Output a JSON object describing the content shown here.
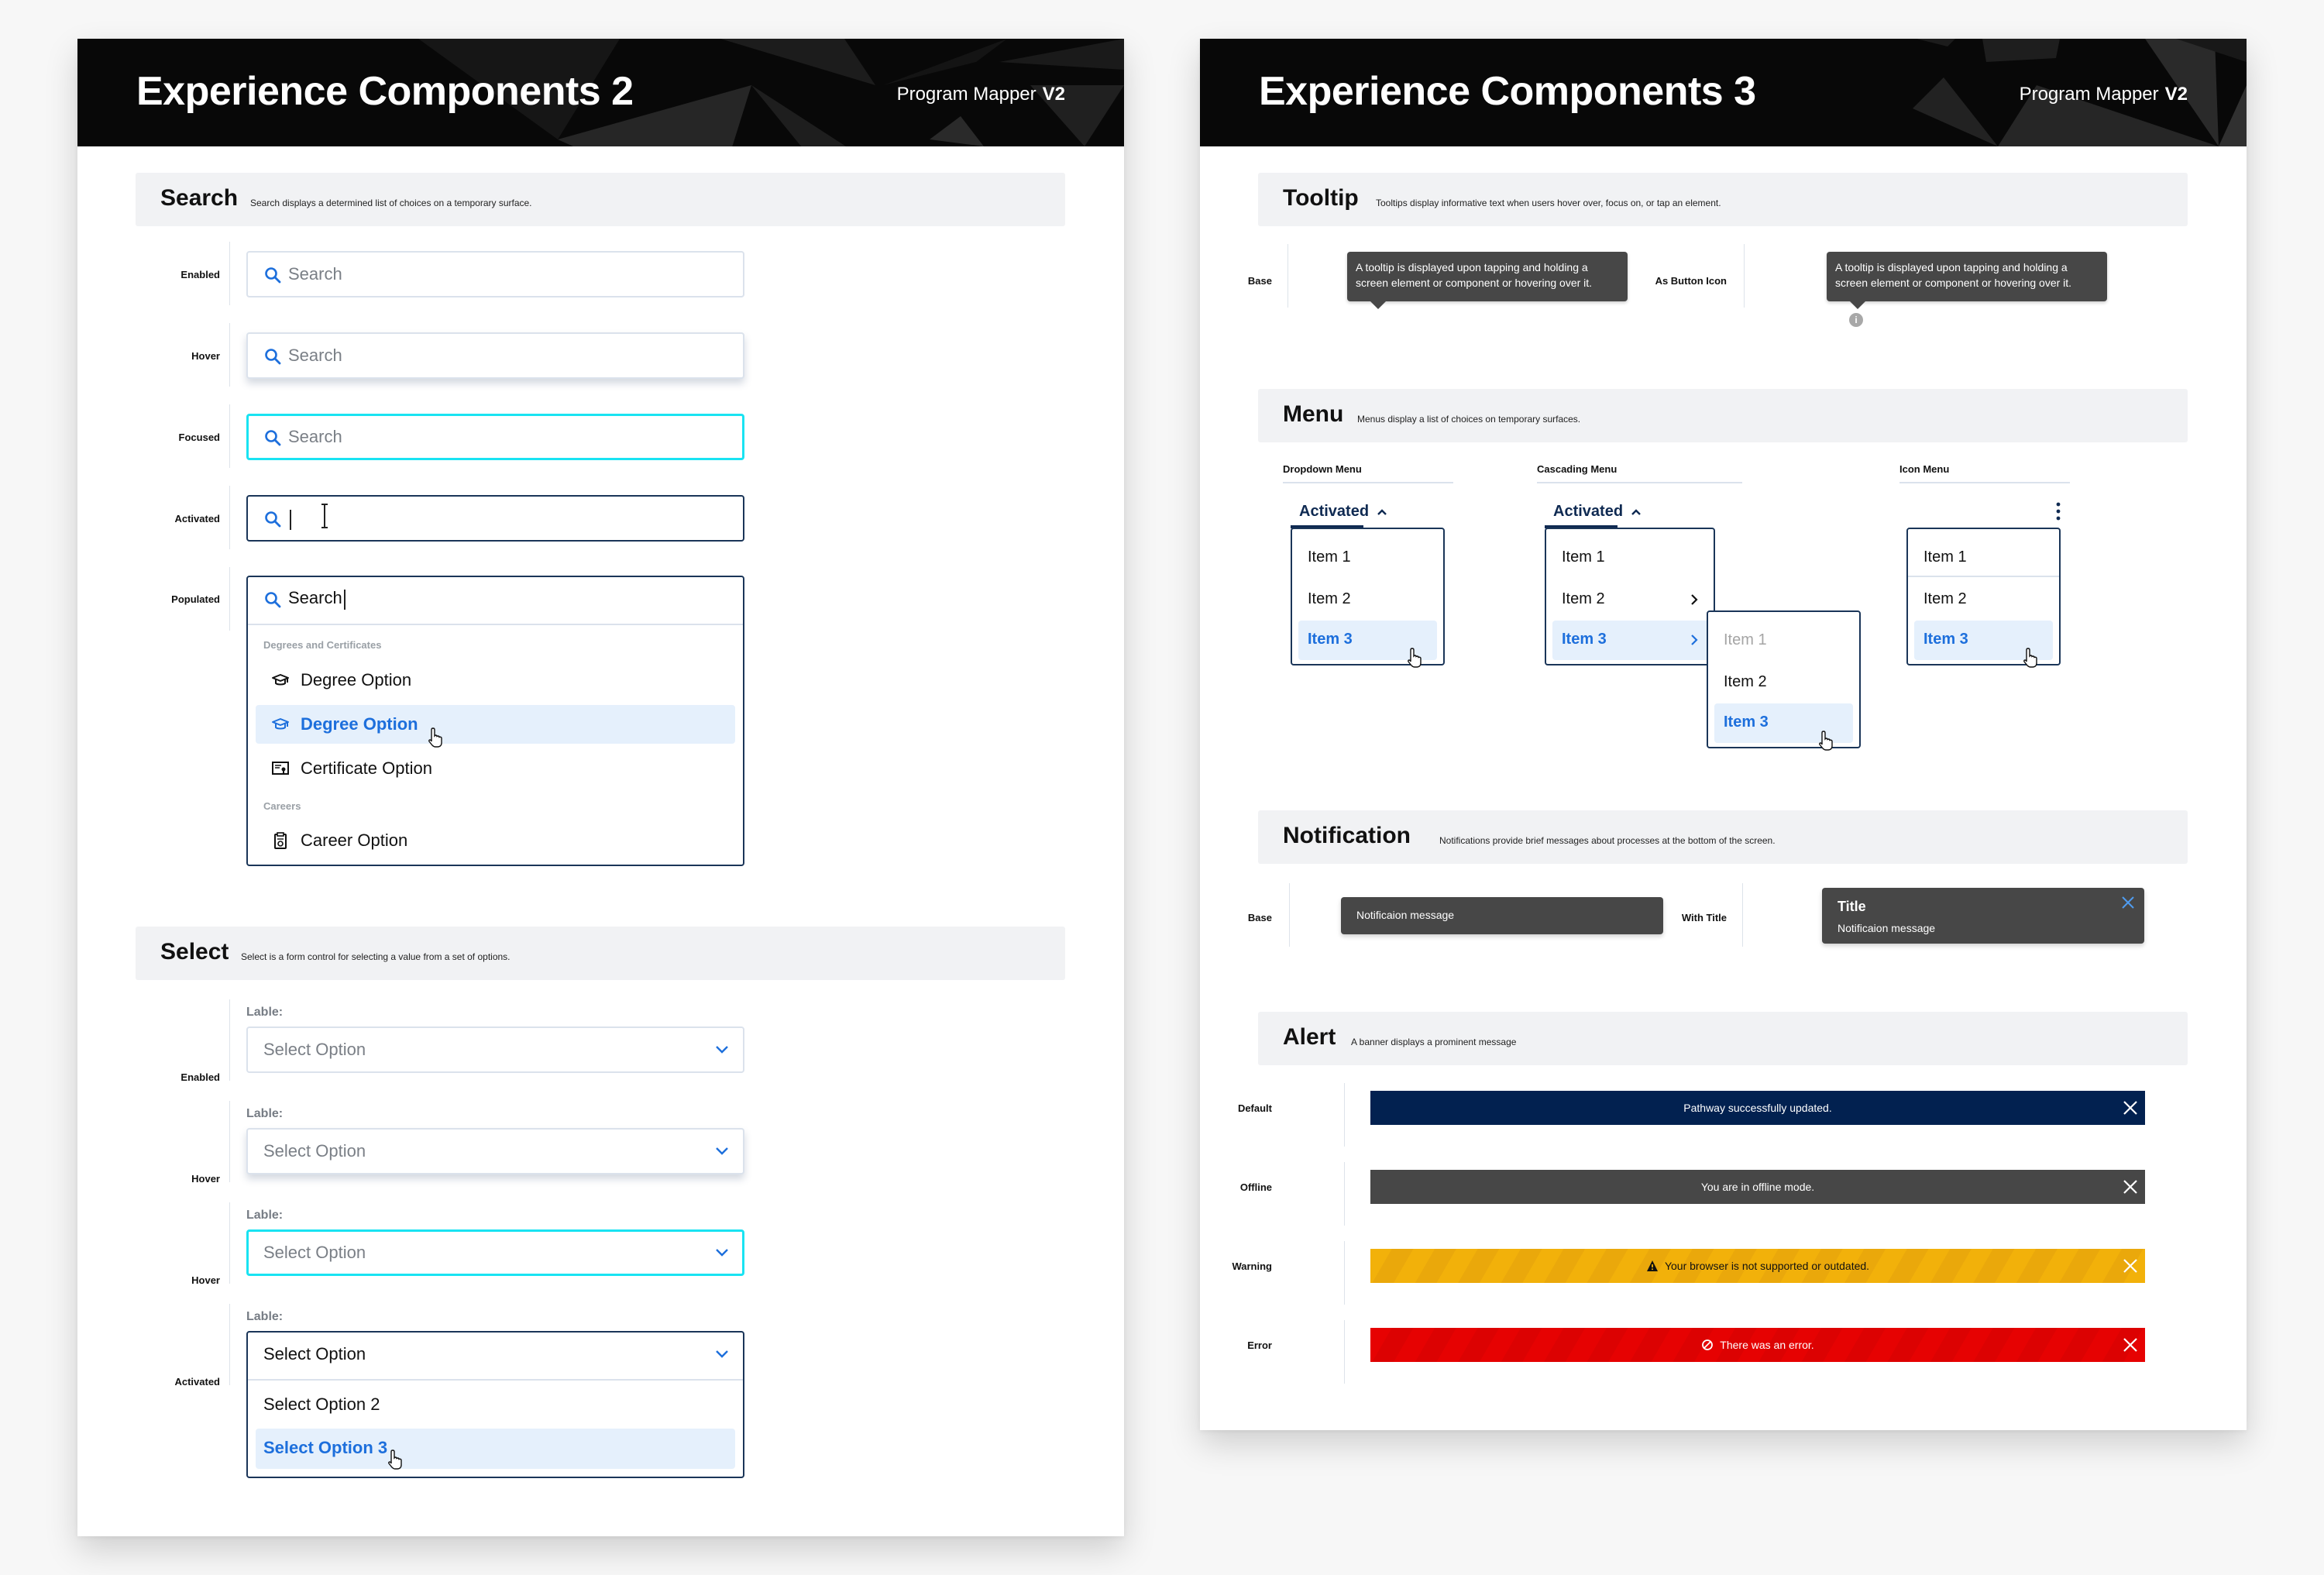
{
  "left_page": {
    "title": "Experience Components 2",
    "brand": "Program Mapper",
    "version": "V2",
    "search": {
      "title": "Search",
      "description": "Search displays a determined list of choices on a temporary surface.",
      "states": [
        {
          "label": "Enabled",
          "placeholder": "Search"
        },
        {
          "label": "Hover",
          "placeholder": "Search"
        },
        {
          "label": "Focused",
          "placeholder": "Search"
        },
        {
          "label": "Activated",
          "value": ""
        },
        {
          "label": "Populated",
          "value": "Search"
        }
      ],
      "results": {
        "groups": [
          {
            "label": "Degrees and Certificates",
            "options": [
              {
                "label": "Degree Option",
                "icon": "graduation-cap-icon",
                "highlighted": false
              },
              {
                "label": "Degree Option",
                "icon": "graduation-cap-icon",
                "highlighted": true
              },
              {
                "label": "Certificate Option",
                "icon": "certificate-icon",
                "highlighted": false
              }
            ]
          },
          {
            "label": "Careers",
            "options": [
              {
                "label": "Career Option",
                "icon": "clipboard-icon",
                "highlighted": false
              }
            ]
          }
        ]
      }
    },
    "select": {
      "title": "Select",
      "description": "Select is a form control for selecting a value from a set of options.",
      "field_label": "Lable:",
      "states": [
        {
          "label": "Enabled",
          "value": "Select Option"
        },
        {
          "label": "Hover",
          "value": "Select Option"
        },
        {
          "label": "Hover",
          "value": "Select Option"
        },
        {
          "label": "Activated",
          "value": "Select Option"
        }
      ],
      "options": [
        {
          "label": "Select Option 2",
          "highlighted": false
        },
        {
          "label": "Select Option 3",
          "highlighted": true
        }
      ]
    }
  },
  "right_page": {
    "title": "Experience Components 3",
    "brand": "Program Mapper",
    "version": "V2",
    "tooltip": {
      "title": "Tooltip",
      "description": "Tooltips display informative text when users hover over, focus on, or tap an element.",
      "variants": [
        {
          "label": "Base",
          "text": "A tooltip is displayed upon tapping and holding a screen element or component or hovering over it."
        },
        {
          "label": "As  Button Icon",
          "text": "A tooltip is displayed upon tapping and holding a screen element or component or hovering over it.",
          "icon": "info-icon",
          "icon_glyph": "i"
        }
      ]
    },
    "menu": {
      "title": "Menu",
      "description": "Menus display a list of choices on temporary surfaces.",
      "dropdown": {
        "label": "Dropdown Menu",
        "trigger": "Activated",
        "items": [
          {
            "label": "Item 1",
            "highlighted": false
          },
          {
            "label": "Item 2",
            "highlighted": false
          },
          {
            "label": "Item 3",
            "highlighted": true
          }
        ]
      },
      "cascading": {
        "label": "Cascading Menu",
        "trigger": "Activated",
        "items": [
          {
            "label": "Item 1",
            "highlighted": false,
            "submenu": false
          },
          {
            "label": "Item 2",
            "highlighted": false,
            "submenu": true
          },
          {
            "label": "Item 3",
            "highlighted": true,
            "submenu": true
          }
        ],
        "submenu_items": [
          {
            "label": "Item 1",
            "disabled": true,
            "highlighted": false
          },
          {
            "label": "Item 2",
            "disabled": false,
            "highlighted": false
          },
          {
            "label": "Item 3",
            "disabled": false,
            "highlighted": true
          }
        ]
      },
      "icon_menu": {
        "label": "Icon Menu",
        "items": [
          {
            "label": "Item 1",
            "highlighted": false
          },
          {
            "label": "Item 2",
            "highlighted": false
          },
          {
            "label": "Item 3",
            "highlighted": true
          }
        ]
      }
    },
    "notification": {
      "title": "Notification",
      "description": "Notifications provide brief messages about processes at the bottom of the screen.",
      "base": {
        "label": "Base",
        "message": "Notificaion message"
      },
      "with_title": {
        "label": "With Title",
        "title": "Title",
        "message": "Notificaion message"
      }
    },
    "alert": {
      "title": "Alert",
      "description": "A banner displays a prominent message",
      "items": [
        {
          "label": "Default",
          "message": "Pathway successfully updated.",
          "color": "#022150"
        },
        {
          "label": "Offline",
          "message": "You are in offline mode.",
          "color": "#474747"
        },
        {
          "label": "Warning",
          "message": "Your browser is not supported or outdated.",
          "color": "#f2b10a",
          "icon": "warning-triangle-icon"
        },
        {
          "label": "Error",
          "message": "There was an error.",
          "color": "#e60202",
          "icon": "prohibited-icon"
        }
      ]
    }
  },
  "colors": {
    "accent_blue": "#1d6fdc",
    "navy": "#0f2a52",
    "focus_cyan": "#19e3f2",
    "highlight_bg": "#e5f0fc",
    "section_bg": "#f1f2f4",
    "header_bg": "#080808"
  }
}
